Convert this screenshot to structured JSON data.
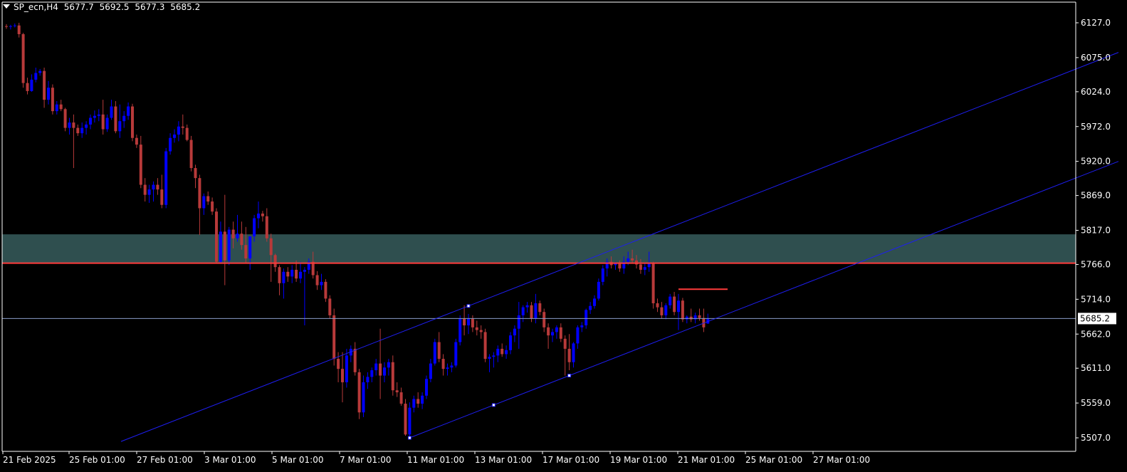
{
  "header": {
    "symbol": "SP_ecn,H4",
    "open": "5677.7",
    "high": "5692.5",
    "low": "5677.3",
    "close": "5685.2"
  },
  "colors": {
    "background": "#000000",
    "bull": "#0000ff",
    "bear": "#b83a3a",
    "zone": "#2f4f4f",
    "resistance_line": "#ff3b3b",
    "channel": "#1e1ef0",
    "axis": "#ffffff"
  },
  "chart_data": {
    "type": "candlestick",
    "ylim": [
      5487,
      6150
    ],
    "price_ticks": [
      "6127.0",
      "6075.0",
      "6024.0",
      "5972.0",
      "5920.0",
      "5869.0",
      "5817.0",
      "5766.0",
      "5714.0",
      "5662.0",
      "5611.0",
      "5559.0",
      "5507.0"
    ],
    "time_labels": [
      "21 Feb 2025",
      "25 Feb 01:00",
      "27 Feb 01:00",
      "3 Mar 01:00",
      "5 Mar 01:00",
      "7 Mar 01:00",
      "11 Mar 01:00",
      "13 Mar 01:00",
      "17 Mar 01:00",
      "19 Mar 01:00",
      "21 Mar 01:00",
      "25 Mar 01:00",
      "27 Mar 01:00"
    ],
    "current_price": "5685.2",
    "resistance_level": 5768,
    "zone": [
      5768,
      5811
    ],
    "short_level": {
      "price": 5729,
      "from_bar": 160,
      "to_bar": 170
    },
    "channel": {
      "lower": {
        "bar1": 96,
        "price1": 5507,
        "bar2": 134,
        "price2": 5600
      },
      "upper_offset_anchor": {
        "bar": 110,
        "price": 5704
      },
      "lower_extended_from_bar": 20
    },
    "marker_points": [
      {
        "bar": 110,
        "price": 5704
      },
      {
        "bar": 116,
        "price": 5556
      },
      {
        "bar": 96,
        "price": 5507
      },
      {
        "bar": 134,
        "price": 5600
      }
    ],
    "ohlc": [
      [
        6122,
        6125,
        6118,
        6121
      ],
      [
        6121,
        6124,
        6117,
        6122
      ],
      [
        6122,
        6126,
        6120,
        6123
      ],
      [
        6123,
        6127,
        6105,
        6110
      ],
      [
        6110,
        6112,
        6030,
        6037
      ],
      [
        6037,
        6045,
        6020,
        6025
      ],
      [
        6025,
        6050,
        6024,
        6042
      ],
      [
        6042,
        6060,
        6038,
        6052
      ],
      [
        6052,
        6058,
        6048,
        6055
      ],
      [
        6055,
        6060,
        6000,
        6012
      ],
      [
        6012,
        6040,
        6005,
        6030
      ],
      [
        6030,
        6035,
        5990,
        5995
      ],
      [
        5995,
        6010,
        5990,
        6005
      ],
      [
        6005,
        6012,
        5995,
        5998
      ],
      [
        5998,
        6000,
        5965,
        5970
      ],
      [
        5970,
        5985,
        5960,
        5978
      ],
      [
        5978,
        5990,
        5910,
        5970
      ],
      [
        5970,
        5975,
        5958,
        5962
      ],
      [
        5962,
        5978,
        5955,
        5970
      ],
      [
        5970,
        5980,
        5960,
        5975
      ],
      [
        5975,
        5990,
        5968,
        5985
      ],
      [
        5985,
        5996,
        5978,
        5988
      ],
      [
        5988,
        5998,
        5980,
        5990
      ],
      [
        5990,
        6012,
        5960,
        5968
      ],
      [
        5968,
        5990,
        5964,
        5985
      ],
      [
        5985,
        6012,
        5982,
        6002
      ],
      [
        6002,
        6010,
        5962,
        5965
      ],
      [
        5965,
        6005,
        5955,
        5980
      ],
      [
        5980,
        5995,
        5970,
        5988
      ],
      [
        5988,
        6008,
        5982,
        6002
      ],
      [
        6002,
        6006,
        5950,
        5955
      ],
      [
        5955,
        5960,
        5940,
        5945
      ],
      [
        5945,
        5958,
        5880,
        5885
      ],
      [
        5885,
        5895,
        5860,
        5870
      ],
      [
        5870,
        5885,
        5858,
        5878
      ],
      [
        5878,
        5890,
        5860,
        5885
      ],
      [
        5885,
        5895,
        5870,
        5878
      ],
      [
        5878,
        5900,
        5850,
        5855
      ],
      [
        5855,
        5940,
        5850,
        5935
      ],
      [
        5935,
        5962,
        5930,
        5955
      ],
      [
        5955,
        5968,
        5948,
        5960
      ],
      [
        5960,
        5980,
        5950,
        5972
      ],
      [
        5972,
        5990,
        5960,
        5970
      ],
      [
        5970,
        5975,
        5950,
        5952
      ],
      [
        5952,
        5958,
        5905,
        5910
      ],
      [
        5910,
        5915,
        5880,
        5895
      ],
      [
        5895,
        5900,
        5810,
        5850
      ],
      [
        5850,
        5872,
        5840,
        5868
      ],
      [
        5868,
        5875,
        5855,
        5860
      ],
      [
        5860,
        5866,
        5840,
        5845
      ],
      [
        5845,
        5850,
        5768,
        5770
      ],
      [
        5770,
        5830,
        5768,
        5815
      ],
      [
        5815,
        5870,
        5735,
        5772
      ],
      [
        5772,
        5822,
        5765,
        5818
      ],
      [
        5818,
        5830,
        5790,
        5805
      ],
      [
        5805,
        5840,
        5800,
        5812
      ],
      [
        5812,
        5830,
        5788,
        5795
      ],
      [
        5795,
        5822,
        5768,
        5775
      ],
      [
        5775,
        5808,
        5758,
        5808
      ],
      [
        5808,
        5840,
        5800,
        5835
      ],
      [
        5835,
        5860,
        5820,
        5842
      ],
      [
        5842,
        5846,
        5830,
        5838
      ],
      [
        5838,
        5850,
        5800,
        5805
      ],
      [
        5805,
        5812,
        5740,
        5780
      ],
      [
        5780,
        5782,
        5755,
        5762
      ],
      [
        5762,
        5765,
        5720,
        5738
      ],
      [
        5738,
        5760,
        5715,
        5755
      ],
      [
        5755,
        5762,
        5740,
        5748
      ],
      [
        5748,
        5765,
        5738,
        5758
      ],
      [
        5758,
        5772,
        5740,
        5745
      ],
      [
        5745,
        5770,
        5738,
        5755
      ],
      [
        5755,
        5762,
        5675,
        5758
      ],
      [
        5758,
        5775,
        5752,
        5770
      ],
      [
        5770,
        5785,
        5745,
        5750
      ],
      [
        5750,
        5756,
        5728,
        5735
      ],
      [
        5735,
        5752,
        5728,
        5740
      ],
      [
        5740,
        5744,
        5710,
        5715
      ],
      [
        5715,
        5720,
        5685,
        5690
      ],
      [
        5690,
        5700,
        5615,
        5625
      ],
      [
        5625,
        5635,
        5590,
        5610
      ],
      [
        5610,
        5635,
        5560,
        5590
      ],
      [
        5590,
        5640,
        5582,
        5630
      ],
      [
        5630,
        5645,
        5620,
        5640
      ],
      [
        5640,
        5650,
        5600,
        5605
      ],
      [
        5605,
        5610,
        5535,
        5545
      ],
      [
        5545,
        5600,
        5538,
        5590
      ],
      [
        5590,
        5605,
        5580,
        5598
      ],
      [
        5598,
        5612,
        5590,
        5608
      ],
      [
        5608,
        5625,
        5600,
        5618
      ],
      [
        5618,
        5670,
        5565,
        5600
      ],
      [
        5600,
        5620,
        5590,
        5612
      ],
      [
        5612,
        5625,
        5600,
        5620
      ],
      [
        5620,
        5630,
        5570,
        5578
      ],
      [
        5578,
        5590,
        5568,
        5575
      ],
      [
        5575,
        5582,
        5555,
        5558
      ],
      [
        5558,
        5565,
        5510,
        5512
      ],
      [
        5512,
        5560,
        5505,
        5552
      ],
      [
        5552,
        5570,
        5545,
        5565
      ],
      [
        5565,
        5575,
        5552,
        5558
      ],
      [
        5558,
        5575,
        5550,
        5570
      ],
      [
        5570,
        5600,
        5565,
        5595
      ],
      [
        5595,
        5625,
        5590,
        5618
      ],
      [
        5618,
        5655,
        5615,
        5650
      ],
      [
        5650,
        5665,
        5620,
        5625
      ],
      [
        5625,
        5632,
        5600,
        5610
      ],
      [
        5610,
        5618,
        5600,
        5612
      ],
      [
        5612,
        5620,
        5605,
        5615
      ],
      [
        5615,
        5655,
        5612,
        5650
      ],
      [
        5650,
        5690,
        5645,
        5685
      ],
      [
        5685,
        5705,
        5660,
        5675
      ],
      [
        5675,
        5692,
        5662,
        5685
      ],
      [
        5685,
        5690,
        5665,
        5672
      ],
      [
        5672,
        5682,
        5660,
        5668
      ],
      [
        5668,
        5675,
        5655,
        5665
      ],
      [
        5665,
        5670,
        5620,
        5625
      ],
      [
        5625,
        5632,
        5605,
        5628
      ],
      [
        5628,
        5635,
        5612,
        5630
      ],
      [
        5630,
        5645,
        5620,
        5640
      ],
      [
        5640,
        5648,
        5628,
        5632
      ],
      [
        5632,
        5645,
        5625,
        5638
      ],
      [
        5638,
        5665,
        5632,
        5660
      ],
      [
        5660,
        5675,
        5650,
        5670
      ],
      [
        5670,
        5710,
        5640,
        5690
      ],
      [
        5690,
        5705,
        5680,
        5702
      ],
      [
        5702,
        5710,
        5694,
        5705
      ],
      [
        5705,
        5710,
        5680,
        5685
      ],
      [
        5685,
        5722,
        5678,
        5708
      ],
      [
        5708,
        5712,
        5690,
        5695
      ],
      [
        5695,
        5700,
        5665,
        5672
      ],
      [
        5672,
        5678,
        5640,
        5660
      ],
      [
        5660,
        5670,
        5650,
        5665
      ],
      [
        5665,
        5675,
        5655,
        5672
      ],
      [
        5672,
        5678,
        5650,
        5655
      ],
      [
        5655,
        5660,
        5600,
        5640
      ],
      [
        5640,
        5662,
        5608,
        5620
      ],
      [
        5620,
        5650,
        5612,
        5648
      ],
      [
        5648,
        5675,
        5640,
        5672
      ],
      [
        5672,
        5680,
        5665,
        5675
      ],
      [
        5675,
        5700,
        5670,
        5698
      ],
      [
        5698,
        5710,
        5692,
        5704
      ],
      [
        5704,
        5720,
        5700,
        5715
      ],
      [
        5715,
        5745,
        5712,
        5740
      ],
      [
        5740,
        5765,
        5735,
        5760
      ],
      [
        5760,
        5775,
        5748,
        5770
      ],
      [
        5770,
        5778,
        5760,
        5765
      ],
      [
        5765,
        5770,
        5758,
        5768
      ],
      [
        5768,
        5772,
        5755,
        5760
      ],
      [
        5760,
        5778,
        5752,
        5770
      ],
      [
        5770,
        5785,
        5765,
        5775
      ],
      [
        5775,
        5788,
        5768,
        5772
      ],
      [
        5772,
        5780,
        5760,
        5766
      ],
      [
        5766,
        5774,
        5752,
        5758
      ],
      [
        5758,
        5768,
        5750,
        5762
      ],
      [
        5762,
        5785,
        5755,
        5768
      ],
      [
        5768,
        5770,
        5700,
        5708
      ],
      [
        5708,
        5715,
        5695,
        5702
      ],
      [
        5702,
        5710,
        5685,
        5690
      ],
      [
        5690,
        5708,
        5684,
        5705
      ],
      [
        5705,
        5722,
        5700,
        5718
      ],
      [
        5718,
        5725,
        5690,
        5695
      ],
      [
        5695,
        5722,
        5668,
        5712
      ],
      [
        5712,
        5716,
        5680,
        5684
      ],
      [
        5684,
        5690,
        5678,
        5688
      ],
      [
        5688,
        5700,
        5680,
        5684
      ],
      [
        5684,
        5694,
        5678,
        5690
      ],
      [
        5690,
        5700,
        5682,
        5686
      ],
      [
        5686,
        5700,
        5665,
        5672
      ],
      [
        5677.7,
        5692.5,
        5677.3,
        5685.2
      ]
    ]
  }
}
